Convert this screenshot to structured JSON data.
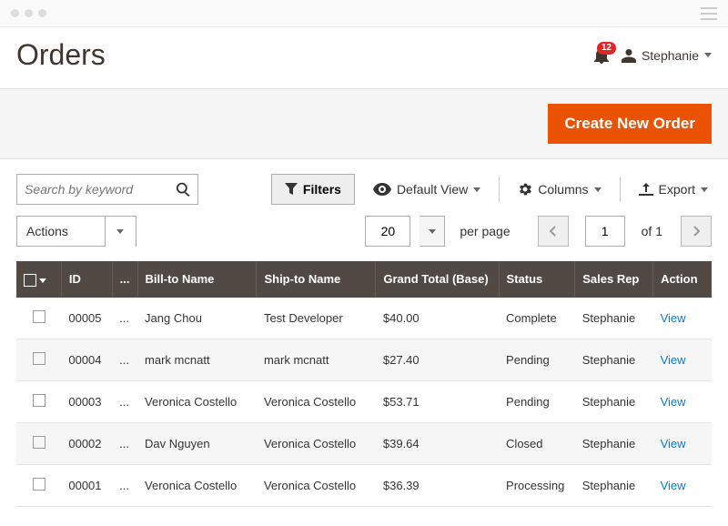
{
  "header": {
    "title": "Orders",
    "notifications_count": "12",
    "username": "Stephanie"
  },
  "action_bar": {
    "create_button": "Create New Order"
  },
  "toolbar": {
    "search_placeholder": "Search by keyword",
    "filters_label": "Filters",
    "default_view_label": "Default View",
    "columns_label": "Columns",
    "export_label": "Export"
  },
  "pager": {
    "actions_label": "Actions",
    "page_size": "20",
    "per_page_label": "per page",
    "current_page": "1",
    "of_label": "of 1"
  },
  "table": {
    "columns": {
      "id": "ID",
      "ellipsis": "...",
      "bill_to": "Bill-to Name",
      "ship_to": "Ship-to Name",
      "grand_total": "Grand Total (Base)",
      "status": "Status",
      "sales_rep": "Sales Rep",
      "action": "Action"
    },
    "view_label": "View",
    "rows": [
      {
        "id": "00005",
        "ell": "...",
        "bill_to": "Jang Chou",
        "ship_to": "Test Developer",
        "grand_total": "$40.00",
        "status": "Complete",
        "sales_rep": "Stephanie"
      },
      {
        "id": "00004",
        "ell": "...",
        "bill_to": "mark mcnatt",
        "ship_to": "mark mcnatt",
        "grand_total": "$27.40",
        "status": "Pending",
        "sales_rep": "Stephanie"
      },
      {
        "id": "00003",
        "ell": "...",
        "bill_to": "Veronica Costello",
        "ship_to": "Veronica Costello",
        "grand_total": "$53.71",
        "status": "Pending",
        "sales_rep": "Stephanie"
      },
      {
        "id": "00002",
        "ell": "...",
        "bill_to": "Dav Nguyen",
        "ship_to": "Veronica Costello",
        "grand_total": "$39.64",
        "status": "Closed",
        "sales_rep": "Stephanie"
      },
      {
        "id": "00001",
        "ell": "...",
        "bill_to": "Veronica Costello",
        "ship_to": "Veronica Costello",
        "grand_total": "$36.39",
        "status": "Processing",
        "sales_rep": "Stephanie"
      }
    ]
  }
}
